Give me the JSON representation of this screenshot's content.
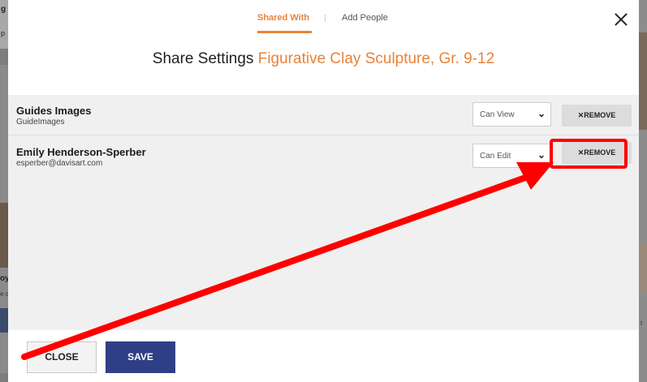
{
  "background": {
    "left_texts": [
      "g",
      "p",
      "oy",
      "e c"
    ],
    "right_text": "t"
  },
  "modal": {
    "tabs": {
      "shared_with": "Shared With",
      "add_people": "Add People"
    },
    "heading": {
      "prefix": "Share Settings",
      "project": "Figurative Clay Sculpture, Gr. 9-12"
    },
    "shares": [
      {
        "name": "Guides Images",
        "sub": "GuideImages",
        "permission": "Can View",
        "remove_label": "✕REMOVE"
      },
      {
        "name": "Emily Henderson-Sperber",
        "sub": "esperber@davisart.com",
        "permission": "Can Edit",
        "remove_label": "✕REMOVE"
      }
    ],
    "footer": {
      "close_label": "CLOSE",
      "save_label": "SAVE"
    }
  },
  "annotation": {
    "color": "#ff0000",
    "kind": "arrow pointing to highlighted remove button"
  },
  "colors": {
    "accent": "#e8833a",
    "primary_button": "#2f3f86",
    "annotation": "#ff0000"
  }
}
